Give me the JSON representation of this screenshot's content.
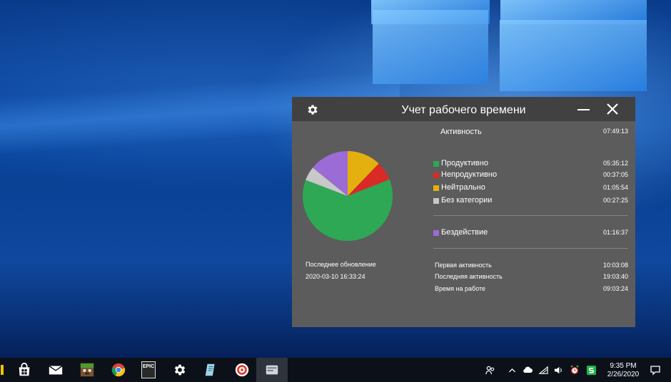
{
  "window": {
    "title": "Учет рабочего времени"
  },
  "activity": {
    "label": "Активность",
    "total": "07:49:13"
  },
  "categories": [
    {
      "label": "Продуктивно",
      "value": "05:35:12",
      "color": "#2ea854",
      "seconds": 20112
    },
    {
      "label": "Непродуктивно",
      "value": "00:37:05",
      "color": "#d92a26",
      "seconds": 2225
    },
    {
      "label": "Нейтрально",
      "value": "01:05:54",
      "color": "#e3b00f",
      "seconds": 3954
    },
    {
      "label": "Без категории",
      "value": "00:27:25",
      "color": "#c8c8c8",
      "seconds": 1645
    }
  ],
  "idle": {
    "label": "Бездействие",
    "value": "01:16:37",
    "color": "#9b6bd6",
    "seconds": 4597
  },
  "last_update": {
    "label": "Последнее обновление",
    "value": "2020-03-10 16:33:24"
  },
  "summary": [
    {
      "label": "Первая активность",
      "value": "10:03:08"
    },
    {
      "label": "Последняя активность",
      "value": "19:03:40"
    },
    {
      "label": "Время на работе",
      "value": "09:03:24"
    }
  ],
  "taskbar": {
    "time": "9:35 PM",
    "date": "2/26/2020",
    "apps": [
      "store-icon",
      "mail-icon",
      "minecraft-icon",
      "chrome-icon",
      "epic-games-icon",
      "settings-icon",
      "notes-icon",
      "app-red-icon",
      "time-tracker-icon"
    ],
    "epic_label": "EPIC"
  }
}
